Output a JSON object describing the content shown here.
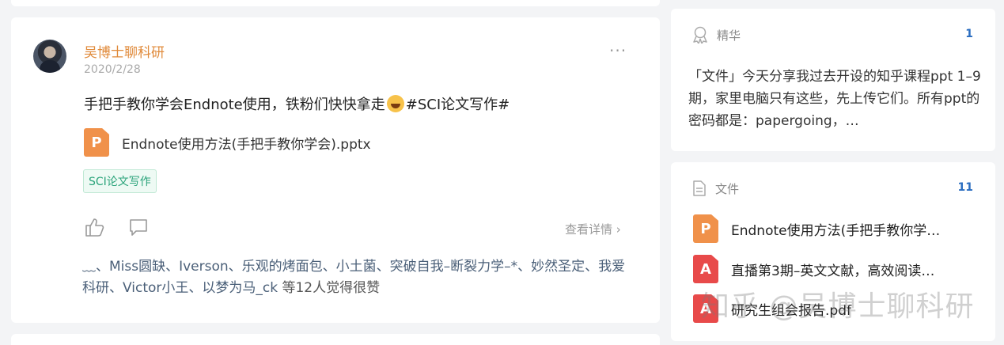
{
  "post": {
    "author": "吴博士聊科研",
    "date": "2020/2/28",
    "more": "···",
    "title_pre": "手把手教你学会Endnote使用，铁粉们快快拿走",
    "title_post": "#SCI论文写作#",
    "attachment": {
      "icon": "P",
      "name": "Endnote使用方法(手把手教你学会).pptx"
    },
    "tag": "SCI论文写作",
    "detail_link": "查看详情 ›",
    "likers": "﹏、Miss圆缺、Iverson、乐观的烤面包、小土菌、突破自我–断裂力学–*、妙然圣定、我爱科研、Victor小王、以梦为马_ck",
    "likers_tail": " 等12人觉得很赞"
  },
  "featured": {
    "label": "精华",
    "count": "1",
    "excerpt": "「文件」今天分享我过去开设的知乎课程ppt 1–9期，家里电脑只有这些，先上传它们。所有ppt的密码都是：papergoing，…"
  },
  "files": {
    "label": "文件",
    "count": "11",
    "items": [
      {
        "icon": "P",
        "name": "Endnote使用方法(手把手教你学…"
      },
      {
        "icon": "A",
        "name": "直播第3期–英文文献，高效阅读…"
      },
      {
        "icon": "A",
        "name": "研究生组会报告.pdf"
      }
    ]
  },
  "watermark": "知乎 @吴博士聊科研",
  "colors": {
    "author": "#e08a3a",
    "count": "#2a6dc0",
    "tag": "#2aa37a",
    "ppt": "#f0914a",
    "pdf": "#e84a4a"
  }
}
